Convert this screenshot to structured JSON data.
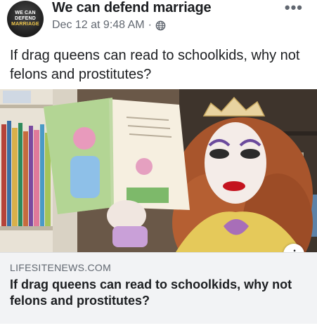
{
  "post": {
    "page_name": "We can defend marriage",
    "timestamp": "Dec 12 at 9:48 AM",
    "separator": "·",
    "more_label": "•••",
    "text": "If drag queens can read to schoolkids, why not felons and prostitutes?"
  },
  "avatar": {
    "line1": "WE CAN",
    "line2": "DEFEND",
    "line3": "MARRIAGE"
  },
  "link_card": {
    "domain": "LIFESITENEWS.COM",
    "title": "If drag queens can read to schoolkids, why not felons and prostitutes?",
    "info_label": "i"
  },
  "icons": {
    "globe": "globe-icon",
    "more": "more-icon",
    "info": "info-icon"
  },
  "colors": {
    "name_text": "#1c1e21",
    "meta_text": "#616770",
    "card_background": "#f2f3f5"
  }
}
